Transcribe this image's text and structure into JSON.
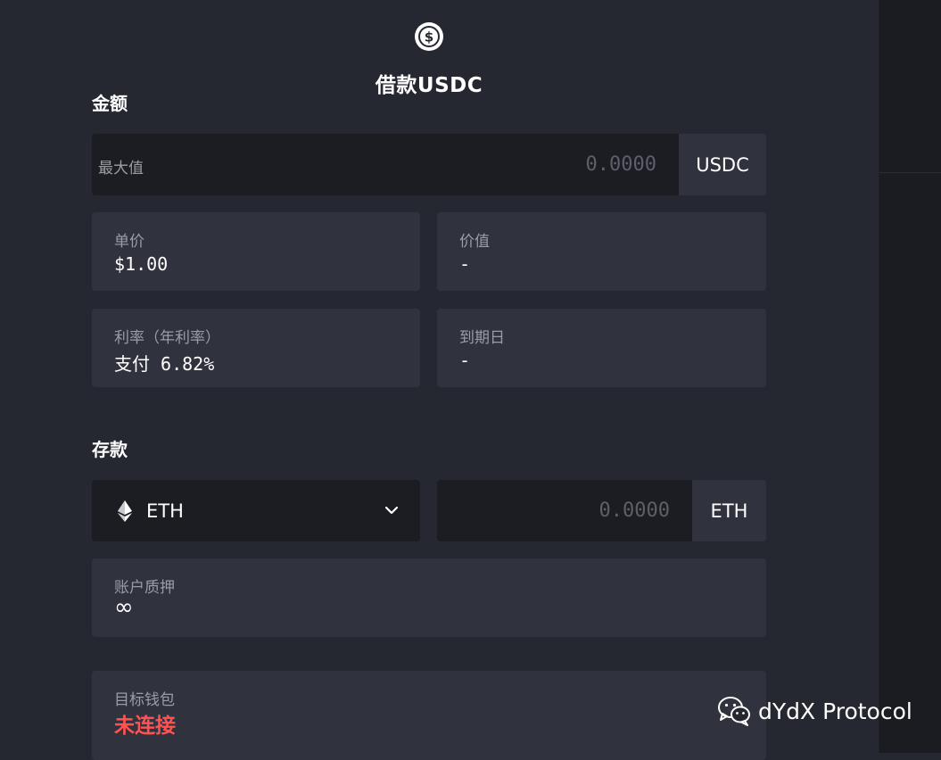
{
  "header": {
    "title": "借款USDC",
    "icon": "usdc-coin-icon"
  },
  "amount": {
    "section_label": "金额",
    "max_label": "最大值",
    "value": "0.0000",
    "unit": "USDC"
  },
  "info": {
    "price": {
      "label": "单价",
      "value": "$1.00"
    },
    "value": {
      "label": "价值",
      "value": "-"
    },
    "rate": {
      "label": "利率（年利率）",
      "value": "支付 6.82%"
    },
    "maturity": {
      "label": "到期日",
      "value": "-"
    }
  },
  "deposit": {
    "section_label": "存款",
    "asset": "ETH",
    "asset_icon": "ethereum-icon",
    "value": "0.0000",
    "unit": "ETH"
  },
  "collateral": {
    "label": "账户质押",
    "value": "∞"
  },
  "wallet": {
    "label": "目标钱包",
    "status": "未连接",
    "status_color": "#ff5353"
  },
  "watermark": {
    "text": "dYdX Protocol",
    "icon": "wechat-icon"
  }
}
